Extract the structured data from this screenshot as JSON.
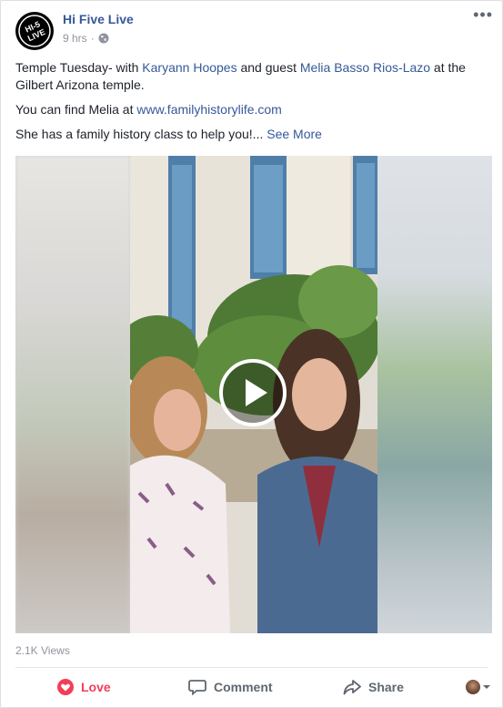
{
  "post": {
    "author": "Hi Five Live",
    "time": "9 hrs",
    "separator": "·",
    "more_label": "•••",
    "text": {
      "line1_pre": "Temple Tuesday- with ",
      "line1_tag1": "Karyann Hoopes",
      "line1_mid": " and guest ",
      "line1_tag2": "Melia Basso Rios-Lazo",
      "line1_post": " at the Gilbert Arizona temple.",
      "line2_pre": "You can find Melia at ",
      "line2_link": "www.familyhistorylife.com",
      "line3_pre": "She has a family history class to help you!... ",
      "see_more": "See More"
    },
    "views": "2.1K Views"
  },
  "actions": {
    "love": "Love",
    "comment": "Comment",
    "share": "Share"
  },
  "colors": {
    "link": "#365899",
    "love": "#f33e58",
    "muted": "#90949c"
  },
  "icons": {
    "avatar": "hi-5-live-logo",
    "globe": "globe-icon",
    "play": "play-icon",
    "love": "heart-icon",
    "comment": "comment-icon",
    "share": "share-icon"
  }
}
